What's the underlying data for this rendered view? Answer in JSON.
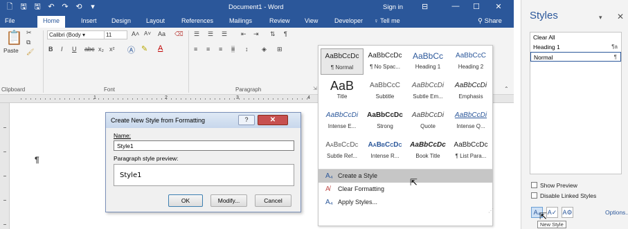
{
  "word": {
    "quick_access": [
      "🗋",
      "🖫",
      "🖫",
      "↶",
      "↷",
      "⟲",
      "▾"
    ],
    "doc_title": "Document1 - Word",
    "sign_in": "Sign in",
    "ribbon_display_icon": "ribbon-display-options-icon",
    "window_controls": [
      "—",
      "☐",
      "✕"
    ],
    "tabs": [
      "File",
      "Home",
      "Insert",
      "Design",
      "Layout",
      "References",
      "Mailings",
      "Review",
      "View",
      "Developer",
      "♀ Tell me"
    ],
    "active_tab": "Home",
    "share": "Share",
    "ribbon": {
      "paste": "Paste",
      "clipboard": "Clipboard",
      "font_name": "Calibri (Body",
      "font_size": "11",
      "font_group": "Font",
      "paragraph_group": "Paragraph",
      "font_buttons": [
        "B",
        "I",
        "U",
        "abc",
        "x₂",
        "x²"
      ],
      "grow_font": "A˄",
      "shrink_font": "A˅",
      "change_case": "Aa",
      "pilcrow": "¶"
    },
    "ruler_numbers": [
      "1",
      "2",
      "3",
      "4"
    ],
    "doc_mark": "¶"
  },
  "gallery": {
    "styles": [
      {
        "sample": "AaBbCcDc",
        "name": "¶ Normal"
      },
      {
        "sample": "AaBbCcDc",
        "name": "¶ No Spac..."
      },
      {
        "sample": "AaBbCc",
        "name": "Heading 1"
      },
      {
        "sample": "AaBbCcC",
        "name": "Heading 2"
      },
      {
        "sample": "AaB",
        "name": "Title"
      },
      {
        "sample": "AaBbCcC",
        "name": "Subtitle"
      },
      {
        "sample": "AaBbCcDi",
        "name": "Subtle Em..."
      },
      {
        "sample": "AaBbCcDi",
        "name": "Emphasis"
      },
      {
        "sample": "AaBbCcDi",
        "name": "Intense E..."
      },
      {
        "sample": "AaBbCcDc",
        "name": "Strong"
      },
      {
        "sample": "AaBbCcDi",
        "name": "Quote"
      },
      {
        "sample": "AaBbCcDi",
        "name": "Intense Q..."
      },
      {
        "sample": "AaBbCcDc",
        "name": "Subtle Ref..."
      },
      {
        "sample": "AaBbCcDc",
        "name": "Intense R..."
      },
      {
        "sample": "AaBbCcDc",
        "name": "Book Title"
      },
      {
        "sample": "AaBbCcDc",
        "name": "¶ List Para..."
      }
    ],
    "menu": [
      {
        "icon": "A₄",
        "label": "Create a Style",
        "accel": "S"
      },
      {
        "icon": "A̸",
        "label": "Clear Formatting",
        "accel": "C"
      },
      {
        "icon": "A₄",
        "label": "Apply Styles...",
        "accel": "A"
      }
    ]
  },
  "dialog": {
    "title": "Create New Style from Formatting",
    "help": "?",
    "close": "✕",
    "name_label": "Name:",
    "name_value": "Style1",
    "preview_label": "Paragraph style preview:",
    "preview_text": "Style1",
    "ok": "OK",
    "modify": "Modify...",
    "cancel": "Cancel"
  },
  "pane": {
    "title": "Styles",
    "dropdown": "▾",
    "close": "✕",
    "items": [
      {
        "name": "Clear All",
        "mark": ""
      },
      {
        "name": "Heading 1",
        "mark": "¶a"
      },
      {
        "name": "Normal",
        "mark": "¶"
      }
    ],
    "selected": "Normal",
    "show_preview": "Show Preview",
    "disable_linked": "Disable Linked Styles",
    "buttons": [
      "A₄",
      "A✓",
      "A⚙"
    ],
    "options": "Options...",
    "tooltip": "New Style"
  },
  "colors": {
    "word_blue": "#2b579a",
    "ribbon_bg": "#f3f3f3",
    "hover_gray": "#c6c6c6"
  }
}
